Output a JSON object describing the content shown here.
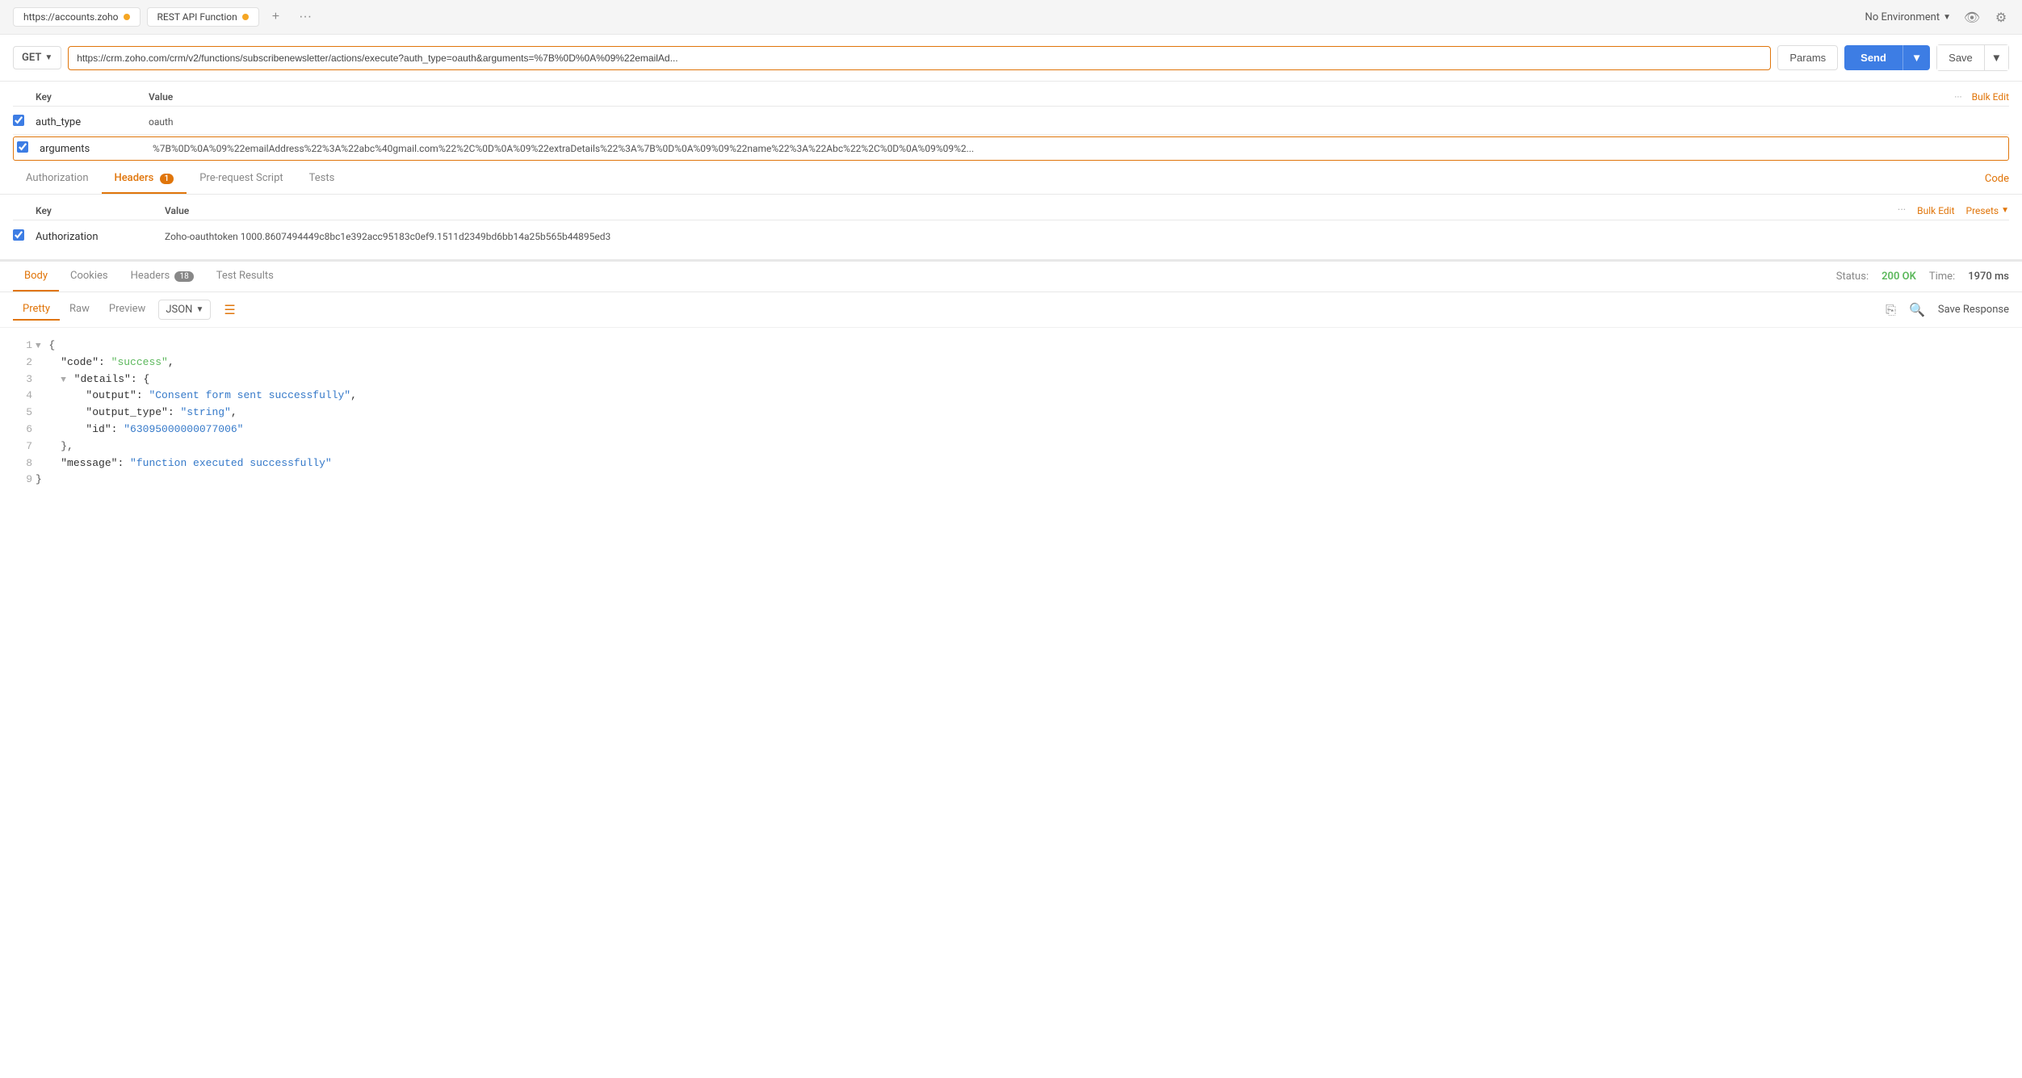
{
  "tabBar": {
    "tab1_label": "https://accounts.zoho",
    "tab1_dot": "orange",
    "tab2_label": "REST API Function",
    "tab2_dot": "orange",
    "plus": "+",
    "more": "···",
    "noEnv": "No Environment",
    "eye_icon": "👁",
    "gear_icon": "⚙"
  },
  "requestBar": {
    "method": "GET",
    "url": "https://crm.zoho.com/crm/v2/functions/subscribenewsletter/actions/execute?auth_type=oauth&arguments=%7B%0D%0A%09%22emailAd...",
    "params_label": "Params",
    "send_label": "Send",
    "save_label": "Save"
  },
  "paramsTable": {
    "col_key": "Key",
    "col_value": "Value",
    "more_icon": "···",
    "bulk_edit": "Bulk Edit",
    "rows": [
      {
        "checked": true,
        "key": "auth_type",
        "value": "oauth",
        "highlighted": false
      },
      {
        "checked": true,
        "key": "arguments",
        "value": "%7B%0D%0A%09%22emailAddress%22%3A%22abc%40gmail.com%22%2C%0D%0A%09%22extraDetails%22%3A%7B%0D%0A%09%09%22name%22%3A%22Abc%22%2C%0D%0A%09%09%2...",
        "highlighted": true
      }
    ]
  },
  "tabs": {
    "authorization": "Authorization",
    "headers": "Headers",
    "headers_count": "1",
    "prerequest": "Pre-request Script",
    "tests": "Tests",
    "code_link": "Code"
  },
  "headersTable": {
    "col_key": "Key",
    "col_value": "Value",
    "more_icon": "···",
    "bulk_edit": "Bulk Edit",
    "presets": "Presets",
    "rows": [
      {
        "checked": true,
        "key": "Authorization",
        "value": "Zoho-oauthtoken 1000.8607494449c8bc1e392acc95183c0ef9.1511d2349bd6bb14a25b565b44895ed3"
      }
    ]
  },
  "responseTabs": {
    "body": "Body",
    "cookies": "Cookies",
    "headers": "Headers",
    "headers_count": "18",
    "test_results": "Test Results",
    "status_label": "Status:",
    "status_value": "200 OK",
    "time_label": "Time:",
    "time_value": "1970 ms"
  },
  "bodyFormat": {
    "pretty": "Pretty",
    "raw": "Raw",
    "preview": "Preview",
    "format": "JSON",
    "save_response": "Save Response"
  },
  "jsonBody": {
    "line1": "{",
    "line2_key": "\"code\"",
    "line2_val": "\"success\"",
    "line3": "\"details\": {",
    "line4_key": "\"output\"",
    "line4_val": "\"Consent form sent successfully\"",
    "line5_key": "\"output_type\"",
    "line5_val": "\"string\"",
    "line6_key": "\"id\"",
    "line6_val": "\"63095000000077006\"",
    "line7": "},",
    "line8_key": "\"message\"",
    "line8_val": "\"function executed successfully\"",
    "line9": "}"
  }
}
